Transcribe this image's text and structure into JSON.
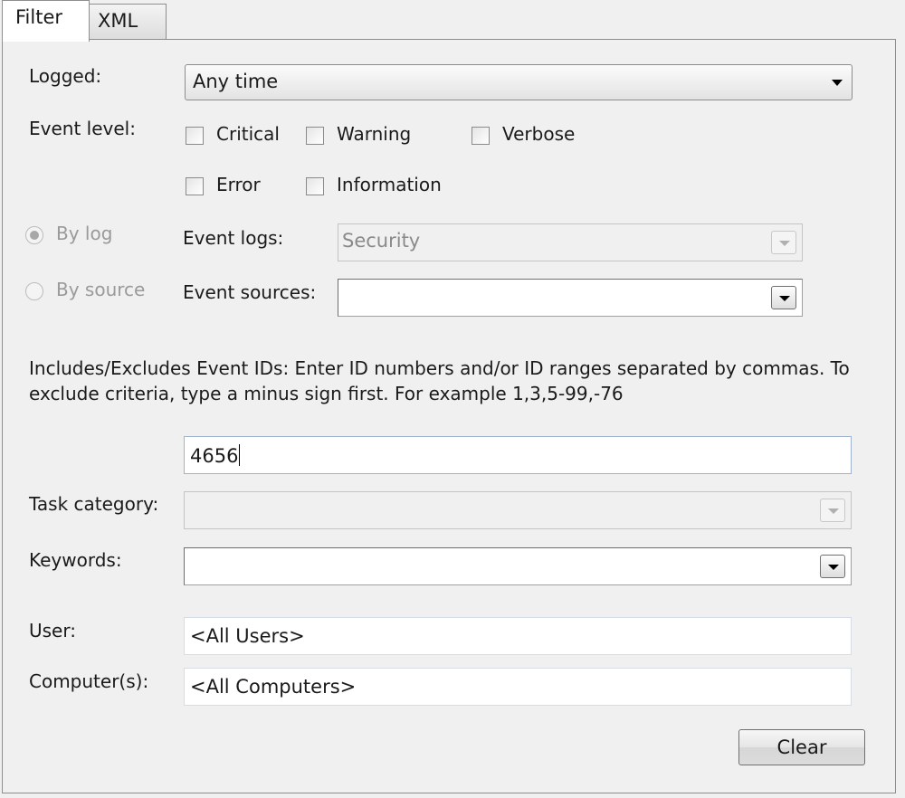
{
  "tabs": [
    {
      "label": "Filter",
      "active": true
    },
    {
      "label": "XML",
      "active": false
    }
  ],
  "logged": {
    "label": "Logged:",
    "value": "Any time"
  },
  "event_level": {
    "label": "Event level:",
    "options": [
      {
        "label": "Critical",
        "checked": false
      },
      {
        "label": "Warning",
        "checked": false
      },
      {
        "label": "Verbose",
        "checked": false
      },
      {
        "label": "Error",
        "checked": false
      },
      {
        "label": "Information",
        "checked": false
      }
    ]
  },
  "by_log": {
    "label": "By log",
    "selected": true,
    "enabled": false
  },
  "by_source": {
    "label": "By source",
    "selected": false,
    "enabled": false
  },
  "event_logs": {
    "label": "Event logs:",
    "value": "Security",
    "enabled": false
  },
  "event_sources": {
    "label": "Event sources:",
    "value": ""
  },
  "event_ids": {
    "description": "Includes/Excludes Event IDs: Enter ID numbers and/or ID ranges separated by commas. To exclude criteria, type a minus sign first. For example 1,3,5-99,-76",
    "value": "4656"
  },
  "task_category": {
    "label": "Task category:",
    "value": "",
    "enabled": false
  },
  "keywords": {
    "label": "Keywords:",
    "value": ""
  },
  "user": {
    "label": "User:",
    "value": "<All Users>"
  },
  "computers": {
    "label": "Computer(s):",
    "value": "<All Computers>"
  },
  "clear_button": {
    "label": "Clear"
  },
  "colors": {
    "panel": "#f0f0f0",
    "disabled_text": "#9a9a9a",
    "border": "#8e8e8e"
  }
}
